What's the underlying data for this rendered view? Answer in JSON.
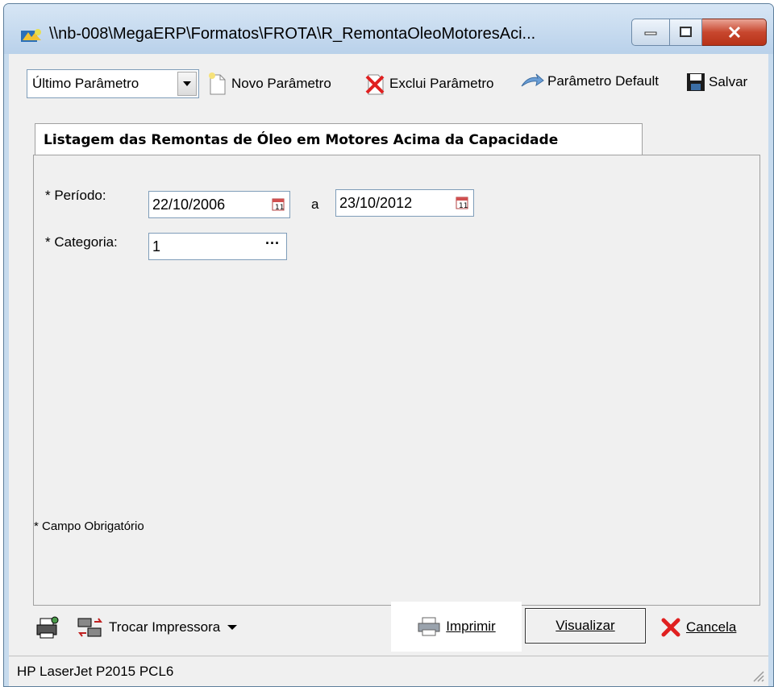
{
  "window": {
    "title": "\\\\nb-008\\MegaERP\\Formatos\\FROTA\\R_RemontaOleoMotoresAci..."
  },
  "toolbar": {
    "param_select_value": "Último Parâmetro",
    "new_param": "Novo Parâmetro",
    "delete_param": "Exclui Parâmetro",
    "default_param": "Parâmetro Default",
    "save": "Salvar"
  },
  "tab": {
    "label": "Listagem das Remontas de Óleo em Motores Acima da Capacidade"
  },
  "form": {
    "periodo_label": "* Período:",
    "periodo_from": "22/10/2006",
    "periodo_sep": "a",
    "periodo_to": "23/10/2012",
    "categoria_label": "* Categoria:",
    "categoria_value": "1",
    "categoria_lookup": "···",
    "required_note": "* Campo Obrigatório"
  },
  "actions": {
    "change_printer": "Trocar Impressora",
    "print": "Imprimir",
    "preview": "Visualizar",
    "cancel": "Cancela"
  },
  "status": {
    "printer": "HP LaserJet P2015 PCL6"
  },
  "colors": {
    "close_red": "#c8472e",
    "delete_red": "#e02020"
  }
}
